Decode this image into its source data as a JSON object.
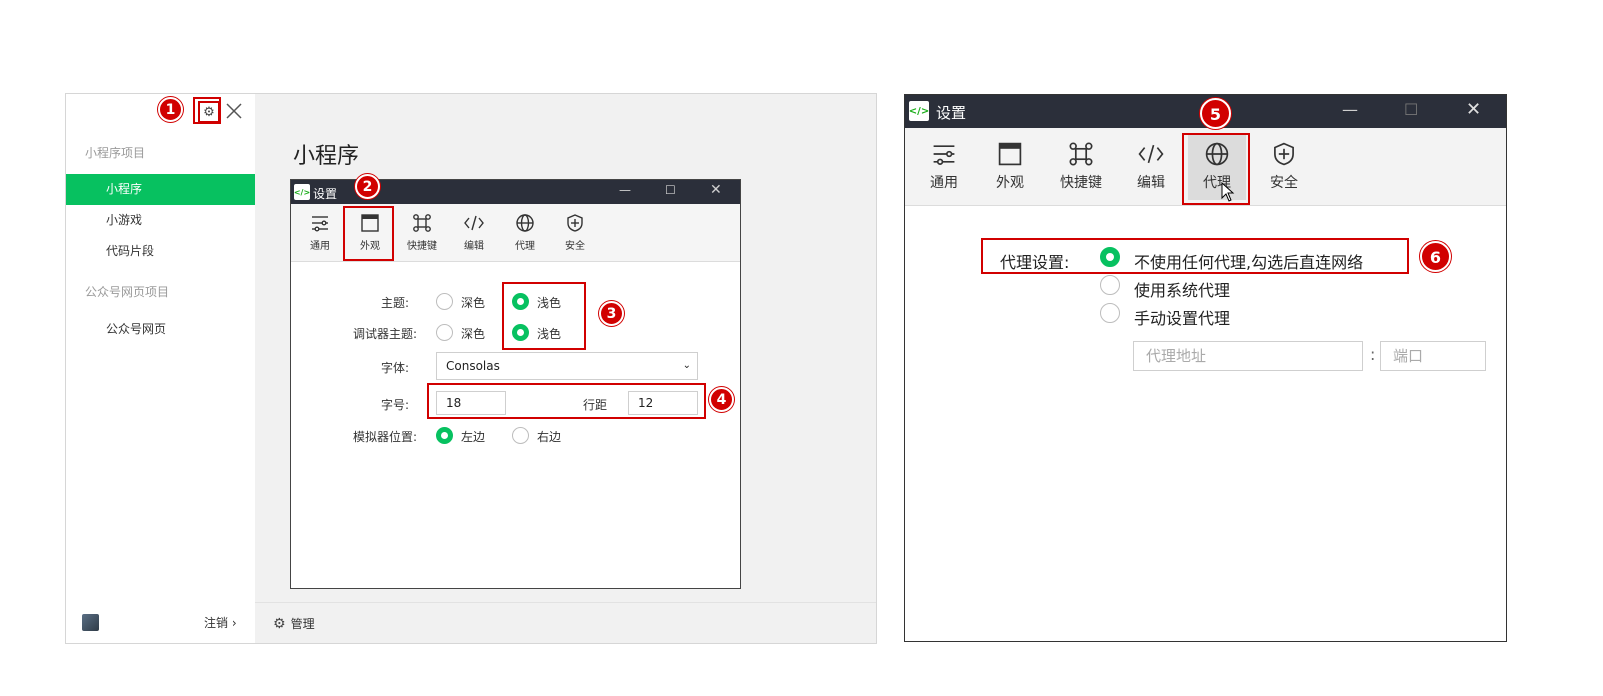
{
  "left_app": {
    "sidebar": {
      "section_miniprogram": "小程序项目",
      "items": [
        {
          "label": "小程序"
        },
        {
          "label": "小游戏"
        },
        {
          "label": "代码片段"
        }
      ],
      "section_official": "公众号网页项目",
      "official_item": "公众号网页",
      "logout": "注销 ›"
    },
    "content_title": "小程序",
    "footer_manage": "管理"
  },
  "small_settings": {
    "title": "设置",
    "toolbar": [
      "通用",
      "外观",
      "快捷键",
      "编辑",
      "代理",
      "安全"
    ],
    "theme_label": "主题:",
    "debugger_theme_label": "调试器主题:",
    "font_label": "字体:",
    "font_value": "Consolas",
    "font_size_label": "字号:",
    "font_size_value": "18",
    "line_height_label": "行距",
    "line_height_value": "12",
    "simulator_label": "模拟器位置:",
    "dark": "深色",
    "light": "浅色",
    "left": "左边",
    "right": "右边"
  },
  "big_settings": {
    "title": "设置",
    "toolbar": [
      "通用",
      "外观",
      "快捷键",
      "编辑",
      "代理",
      "安全"
    ],
    "proxy_label": "代理设置:",
    "options": [
      "不使用任何代理,勾选后直连网络",
      "使用系统代理",
      "手动设置代理"
    ],
    "selected_option": "不使用任何代理,勾选后直连网络",
    "address_placeholder": "代理地址",
    "colon": ":",
    "port_placeholder": "端口"
  },
  "badges": [
    "1",
    "2",
    "3",
    "4",
    "5",
    "6"
  ],
  "colors": {
    "accent_green": "#07c160",
    "highlight_red": "#d10000",
    "titlebar": "#2b2f3a"
  }
}
